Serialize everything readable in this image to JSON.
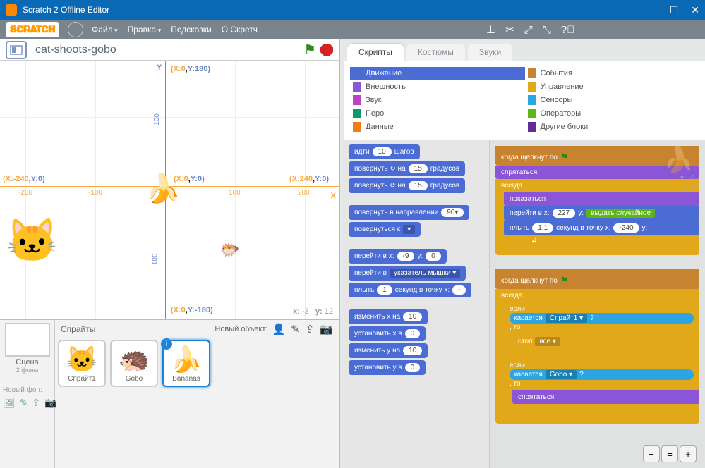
{
  "window": {
    "title": "Scratch 2 Offline Editor"
  },
  "menubar": {
    "logo": "SCRATCH",
    "items": [
      "Файл",
      "Правка",
      "Подсказки",
      "О Скретч"
    ]
  },
  "stage_header": {
    "view_sub": "y447",
    "project_title": "cat-shoots-gobo"
  },
  "coord_labels": {
    "y_axis": "Y",
    "x_axis": "X",
    "top": "(X:0,Y:180)",
    "bottom": "(X:0,Y:-180)",
    "left": "(X:-240,Y:0)",
    "center": "(X:0,Y:0)",
    "right": "(X:240,Y:0)",
    "ticks": {
      "n200": "-200",
      "n100": "-100",
      "p100": "100",
      "p200": "200"
    }
  },
  "coord_readout": {
    "x_label": "x:",
    "x": "-3",
    "y_label": "y:",
    "y": "12"
  },
  "sprite_panel": {
    "sprites_label": "Спрайты",
    "new_object": "Новый объект:",
    "stage_label": "Сцена",
    "stage_sub": "2 фоны",
    "new_bg": "Новый фон:",
    "sprites": [
      {
        "name": "Спрайт1",
        "emoji": "🐱"
      },
      {
        "name": "Gobo",
        "emoji": "🦔"
      },
      {
        "name": "Bananas",
        "emoji": "🍌",
        "selected": true
      }
    ]
  },
  "tabs": {
    "scripts": "Скрипты",
    "costumes": "Костюмы",
    "sounds": "Звуки"
  },
  "categories": {
    "left": [
      {
        "label": "Движение",
        "color": "#4a6cd4",
        "active": true
      },
      {
        "label": "Внешность",
        "color": "#8a55d7"
      },
      {
        "label": "Звук",
        "color": "#bb42c3"
      },
      {
        "label": "Перо",
        "color": "#0e9a6c"
      },
      {
        "label": "Данные",
        "color": "#ee7d16"
      }
    ],
    "right": [
      {
        "label": "События",
        "color": "#c88330"
      },
      {
        "label": "Управление",
        "color": "#e1a91a"
      },
      {
        "label": "Сенсоры",
        "color": "#2ca5e2"
      },
      {
        "label": "Операторы",
        "color": "#5cb712"
      },
      {
        "label": "Другие блоки",
        "color": "#632d99"
      }
    ]
  },
  "palette_blocks": {
    "move_steps": {
      "text1": "идти",
      "val": "10",
      "text2": "шагов"
    },
    "turn_cw": {
      "text1": "повернуть ↻ на",
      "val": "15",
      "text2": "градусов"
    },
    "turn_ccw": {
      "text1": "повернуть ↺ на",
      "val": "15",
      "text2": "градусов"
    },
    "point_dir": {
      "text1": "повернуть в направлении",
      "val": "90▾"
    },
    "point_towards": {
      "text1": "повернуться к",
      "val": "▾"
    },
    "goto_xy": {
      "text1": "перейти в x:",
      "x": "-9",
      "text2": "y:",
      "y": "0"
    },
    "goto": {
      "text1": "перейти в",
      "val": "указатель мышки ▾"
    },
    "glide": {
      "text1": "плыть",
      "s": "1",
      "text2": "секунд в точку x:",
      "x": "-"
    },
    "change_x": {
      "text1": "изменить x на",
      "val": "10"
    },
    "set_x": {
      "text1": "установить x в",
      "val": "0"
    },
    "change_y": {
      "text1": "изменить y на",
      "val": "10"
    },
    "set_y": {
      "text1": "установить y в",
      "val": "0"
    }
  },
  "script_area": {
    "sprite_info": {
      "x_label": "x:",
      "x": "-9",
      "y_label": "y:",
      "y": "0"
    },
    "stack1": {
      "hat": "когда щелкнут по",
      "hide": "спрятаться",
      "forever": "всегда",
      "show": "показаться",
      "goto": {
        "text1": "перейти в x:",
        "x": "227",
        "text2": "y:",
        "rand": "выдать случайное"
      },
      "glide": {
        "text1": "плыть",
        "s": "1.1",
        "text2": "секунд в точку x:",
        "x": "-240",
        "text3": "y:"
      }
    },
    "stack2": {
      "hat": "когда щелкнут по",
      "forever": "всегда",
      "if1": {
        "text1": "если",
        "touch": "касается",
        "target": "Спрайт1 ▾",
        "q": "?",
        "then": ", то"
      },
      "stop": {
        "text": "стоп",
        "val": "все ▾"
      },
      "if2": {
        "text1": "если",
        "touch": "касается",
        "target": "Gobo ▾",
        "q": "?",
        "then": ", то"
      },
      "hide": "спрятаться"
    }
  }
}
